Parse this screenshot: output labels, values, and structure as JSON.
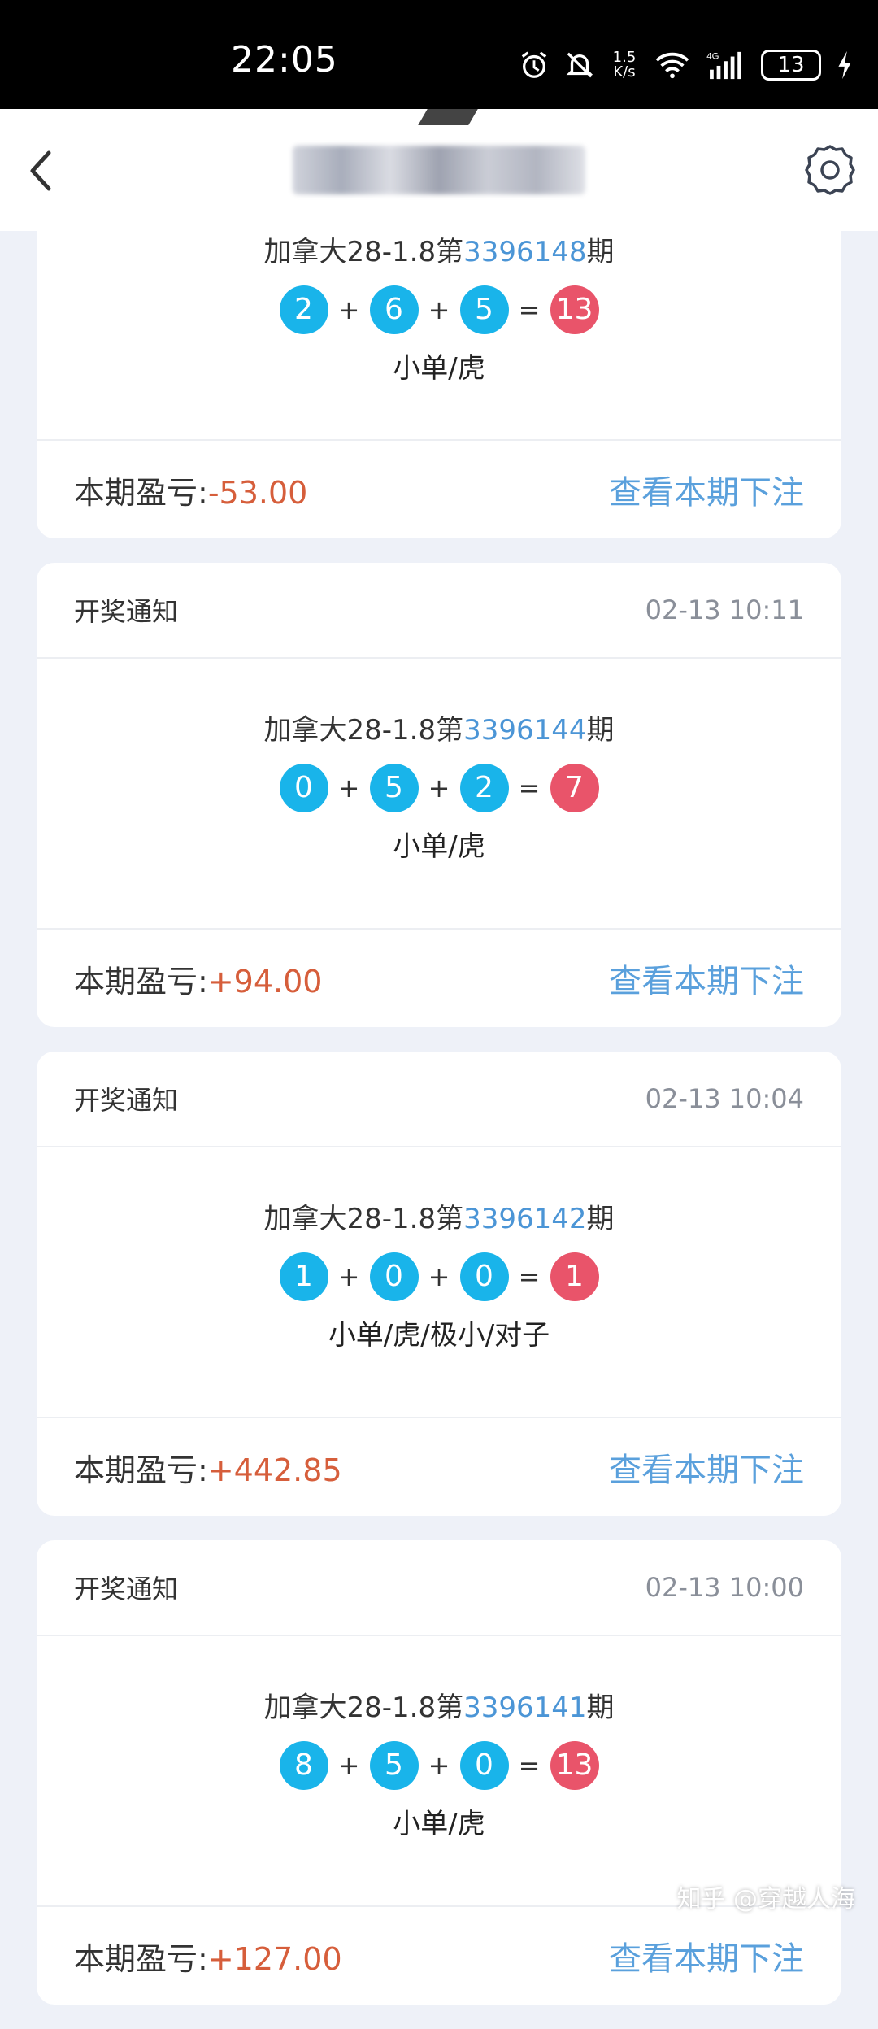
{
  "status_bar": {
    "time": "22:05",
    "net_speed_top": "1.5",
    "net_speed_bottom": "K/s",
    "network": "4G",
    "battery": "13"
  },
  "header": {
    "title": ""
  },
  "labels": {
    "notice": "开奖通知",
    "profit_label": "本期盈亏:",
    "view_bets": "查看本期下注",
    "game_prefix": "加拿大28-1.8第",
    "issue_suffix": "期"
  },
  "cards": [
    {
      "time": "",
      "issue": "3396148",
      "balls": [
        "2",
        "6",
        "5"
      ],
      "sum": "13",
      "result": "小单/虎",
      "profit": "-53.00"
    },
    {
      "time": "02-13 10:11",
      "issue": "3396144",
      "balls": [
        "0",
        "5",
        "2"
      ],
      "sum": "7",
      "result": "小单/虎",
      "profit": "+94.00"
    },
    {
      "time": "02-13 10:04",
      "issue": "3396142",
      "balls": [
        "1",
        "0",
        "0"
      ],
      "sum": "1",
      "result": "小单/虎/极小/对子",
      "profit": "+442.85"
    },
    {
      "time": "02-13 10:00",
      "issue": "3396141",
      "balls": [
        "8",
        "5",
        "0"
      ],
      "sum": "13",
      "result": "小单/虎",
      "profit": "+127.00"
    }
  ],
  "watermark": "知乎 @穿越人海",
  "colors": {
    "ball": "#19b4ea",
    "sum_ball": "#e9546a",
    "link": "#5aa0dc",
    "profit": "#d65e3b",
    "issue": "#4b95d6"
  }
}
